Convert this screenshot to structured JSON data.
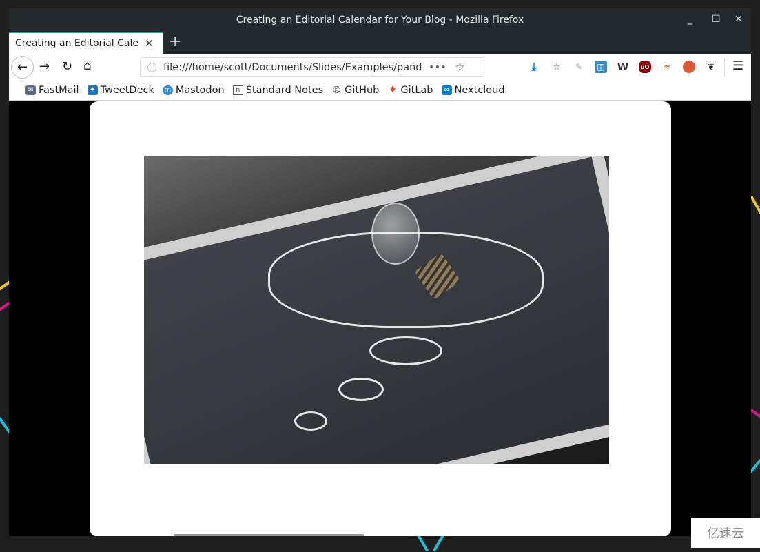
{
  "window": {
    "title": "Creating an Editorial Calendar for Your Blog - Mozilla Firefox",
    "controls": [
      "minimize",
      "maximize",
      "close"
    ]
  },
  "tab": {
    "title": "Creating an Editorial Calendar for Your Blog",
    "close": "✕",
    "new_tab": "+"
  },
  "toolbar": {
    "url": "file:///home/scott/Documents/Slides/Examples/pandoc",
    "more": "•••"
  },
  "extensions": [
    "download-icon",
    "pocket-icon",
    "pin-icon",
    "bitwarden-icon",
    "wallabag-icon",
    "ublock-icon",
    "privacy-badger-icon",
    "duckduckgo-icon",
    "gnome-icon"
  ],
  "bookmarks": [
    {
      "label": "FastMail",
      "icon": "mail-icon",
      "color": "#5b6b87"
    },
    {
      "label": "TweetDeck",
      "icon": "tweetdeck-icon",
      "color": "#1a73b8"
    },
    {
      "label": "Mastodon",
      "icon": "mastodon-icon",
      "color": "#3088d4"
    },
    {
      "label": "Standard Notes",
      "icon": "standard-notes-icon",
      "color": "#555555"
    },
    {
      "label": "GitHub",
      "icon": "globe-icon",
      "color": "#333333"
    },
    {
      "label": "GitLab",
      "icon": "gitlab-icon",
      "color": "#e24329"
    },
    {
      "label": "Nextcloud",
      "icon": "nextcloud-icon",
      "color": "#0082c9"
    }
  ],
  "watermark": "亿速云"
}
